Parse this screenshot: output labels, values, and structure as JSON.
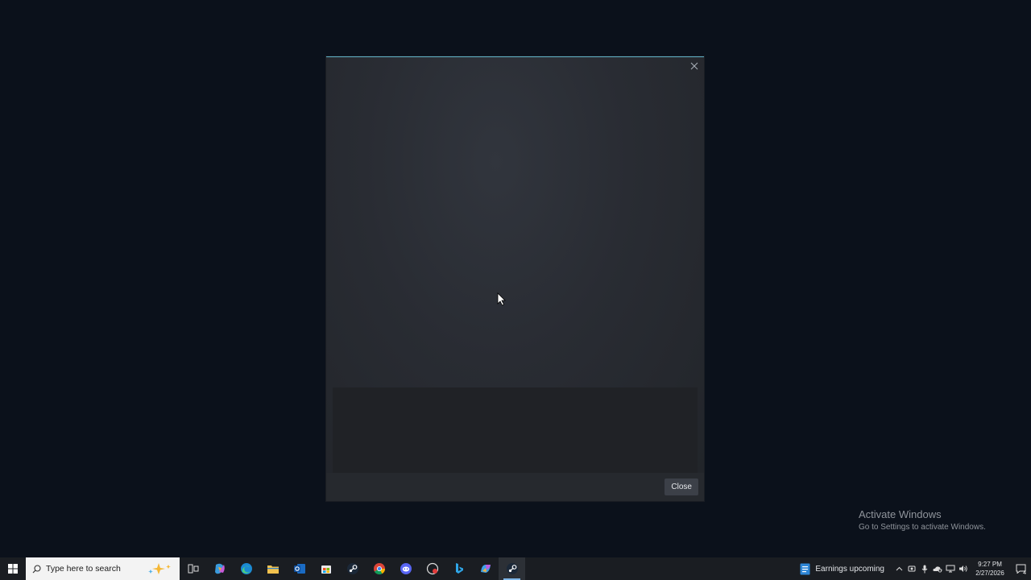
{
  "dialog": {
    "close_button_label": "Close",
    "accent_color": "#5fb3c9"
  },
  "watermark": {
    "title": "Activate Windows",
    "subtitle": "Go to Settings to activate Windows."
  },
  "taskbar": {
    "search_placeholder": "Type here to search",
    "pinned": [
      {
        "name": "task-view-icon"
      },
      {
        "name": "copilot-icon"
      },
      {
        "name": "edge-icon"
      },
      {
        "name": "file-explorer-icon"
      },
      {
        "name": "outlook-icon"
      },
      {
        "name": "store-icon"
      },
      {
        "name": "steam-icon"
      },
      {
        "name": "chrome-icon"
      },
      {
        "name": "discord-icon"
      },
      {
        "name": "app-icon"
      },
      {
        "name": "bing-icon"
      },
      {
        "name": "copilot-app-icon"
      },
      {
        "name": "steam-active-icon"
      }
    ],
    "weather_text": "Earnings upcoming",
    "clock_time": "9:27 PM",
    "clock_date": "2/27/2026",
    "notification_count": "4"
  }
}
